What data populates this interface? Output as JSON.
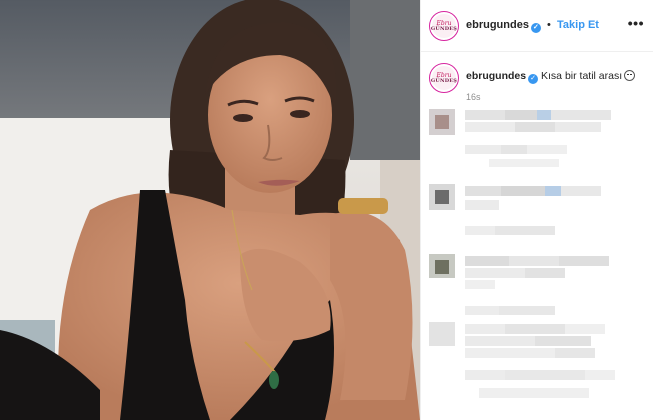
{
  "post": {
    "header": {
      "avatar_text_top": "Ebru",
      "avatar_text_bottom": "GÜNDEŞ",
      "username": "ebrugundes",
      "verified_mark": "✓",
      "separator": "•",
      "follow_label": "Takip Et",
      "more_label": "•••"
    },
    "caption": {
      "username": "ebrugundes",
      "text": "Kısa bir tatil arası",
      "emoji": "smiling-face",
      "time": "16s"
    },
    "colors": {
      "accent": "#3897f0",
      "text": "#262626",
      "muted": "#8e8e8e",
      "avatar_ring": "#d6249f",
      "border": "#efefef"
    },
    "comments": [
      {
        "state": "pixelated"
      },
      {
        "state": "pixelated"
      },
      {
        "state": "pixelated"
      },
      {
        "state": "pixelated"
      }
    ]
  }
}
